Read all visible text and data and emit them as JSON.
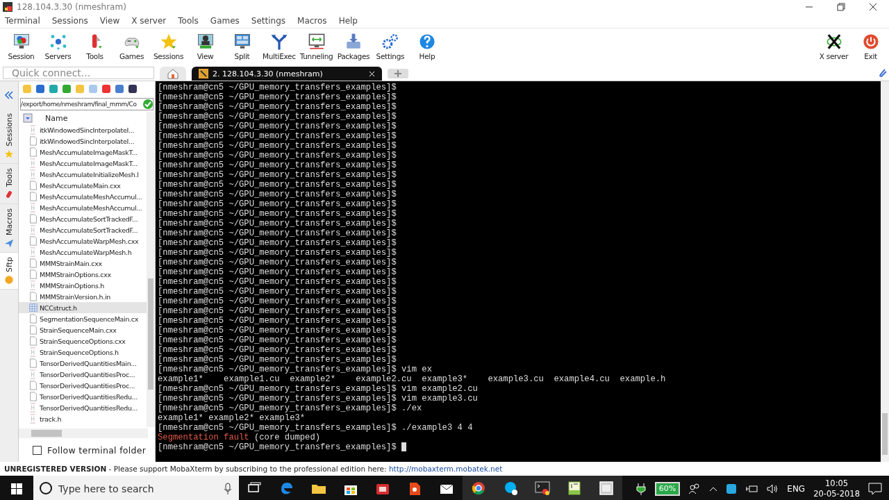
{
  "window": {
    "title": "128.104.3.30 (nmeshram)"
  },
  "menu": [
    "Terminal",
    "Sessions",
    "View",
    "X server",
    "Tools",
    "Games",
    "Settings",
    "Macros",
    "Help"
  ],
  "toolbar": [
    {
      "label": "Session",
      "kind": "monitor"
    },
    {
      "label": "Servers",
      "kind": "network"
    },
    {
      "label": "Tools",
      "kind": "knife"
    },
    {
      "label": "Games",
      "kind": "gamepad"
    },
    {
      "label": "Sessions",
      "kind": "star"
    },
    {
      "label": "View",
      "kind": "person"
    },
    {
      "label": "Split",
      "kind": "split"
    },
    {
      "label": "MultiExec",
      "kind": "fork"
    },
    {
      "label": "Tunneling",
      "kind": "tunnel"
    },
    {
      "label": "Packages",
      "kind": "package"
    },
    {
      "label": "Settings",
      "kind": "gears"
    },
    {
      "label": "Help",
      "kind": "help"
    }
  ],
  "toolbar_right": [
    {
      "label": "X server",
      "kind": "xlogo"
    },
    {
      "label": "Exit",
      "kind": "power"
    }
  ],
  "quick_connect": {
    "placeholder": "Quick connect..."
  },
  "tabs": [
    {
      "kind": "home",
      "selected": false
    },
    {
      "kind": "session",
      "label": "2. 128.104.3.30 (nmeshram)",
      "selected": true
    }
  ],
  "side_tabs": [
    {
      "label": "Sessions",
      "kind": "star",
      "selected": false
    },
    {
      "label": "Tools",
      "kind": "knife",
      "selected": false
    },
    {
      "label": "Macros",
      "kind": "plane",
      "selected": false
    },
    {
      "label": "Sftp",
      "kind": "globe",
      "selected": true
    }
  ],
  "sftp": {
    "path": "/export/home/nmeshram/final_mmm/Co",
    "column": "Name",
    "files": [
      {
        "name": "itkWindowedSincInterpolateI...",
        "kind": "header",
        "selected": false
      },
      {
        "name": "itkWindowedSincInterpolateI...",
        "kind": "doc",
        "selected": false
      },
      {
        "name": "MeshAccumulateImageMaskT...",
        "kind": "doc",
        "selected": false
      },
      {
        "name": "MeshAccumulateImageMaskT...",
        "kind": "header",
        "selected": false
      },
      {
        "name": "MeshAccumulateInitializeMesh.l",
        "kind": "header",
        "selected": false
      },
      {
        "name": "MeshAccumulateMain.cxx",
        "kind": "doc",
        "selected": false
      },
      {
        "name": "MeshAccumulateMeshAccumul...",
        "kind": "doc",
        "selected": false
      },
      {
        "name": "MeshAccumulateMeshAccumul...",
        "kind": "header",
        "selected": false
      },
      {
        "name": "MeshAccumulateSortTrackedF...",
        "kind": "doc",
        "selected": false
      },
      {
        "name": "MeshAccumulateSortTrackedF...",
        "kind": "header",
        "selected": false
      },
      {
        "name": "MeshAccumulateWarpMesh.cxx",
        "kind": "doc",
        "selected": false
      },
      {
        "name": "MeshAccumulateWarpMesh.h",
        "kind": "header",
        "selected": false
      },
      {
        "name": "MMMStrainMain.cxx",
        "kind": "doc",
        "selected": false
      },
      {
        "name": "MMMStrainOptions.cxx",
        "kind": "doc",
        "selected": false
      },
      {
        "name": "MMMStrainOptions.h",
        "kind": "header",
        "selected": false
      },
      {
        "name": "MMMStrainVersion.h.in",
        "kind": "doc",
        "selected": false
      },
      {
        "name": "NCCstruct.h",
        "kind": "grid",
        "selected": true
      },
      {
        "name": "SegmentationSequenceMain.cx",
        "kind": "doc",
        "selected": false
      },
      {
        "name": "StrainSequenceMain.cxx",
        "kind": "doc",
        "selected": false
      },
      {
        "name": "StrainSequenceOptions.cxx",
        "kind": "doc",
        "selected": false
      },
      {
        "name": "StrainSequenceOptions.h",
        "kind": "header",
        "selected": false
      },
      {
        "name": "TensorDerivedQuantitiesMain...",
        "kind": "doc",
        "selected": false
      },
      {
        "name": "TensorDerivedQuantitiesProc...",
        "kind": "header",
        "selected": false
      },
      {
        "name": "TensorDerivedQuantitiesProc...",
        "kind": "doc",
        "selected": false
      },
      {
        "name": "TensorDerivedQuantitiesRedu...",
        "kind": "doc",
        "selected": false
      },
      {
        "name": "TensorDerivedQuantitiesRedu...",
        "kind": "header",
        "selected": false
      },
      {
        "name": "track.h",
        "kind": "header",
        "selected": false
      }
    ],
    "follow_terminal": {
      "label": "Follow terminal folder",
      "checked": false
    }
  },
  "terminal": {
    "lines": [
      [
        {
          "text": "[nmeshram@cn5 ~/GPU_memory_transfers_examples]$",
          "kind": "normal"
        }
      ],
      [
        {
          "text": "[nmeshram@cn5 ~/GPU_memory_transfers_examples]$",
          "kind": "normal"
        }
      ],
      [
        {
          "text": "[nmeshram@cn5 ~/GPU_memory_transfers_examples]$",
          "kind": "normal"
        }
      ],
      [
        {
          "text": "[nmeshram@cn5 ~/GPU_memory_transfers_examples]$",
          "kind": "normal"
        }
      ],
      [
        {
          "text": "[nmeshram@cn5 ~/GPU_memory_transfers_examples]$",
          "kind": "normal"
        }
      ],
      [
        {
          "text": "[nmeshram@cn5 ~/GPU_memory_transfers_examples]$",
          "kind": "normal"
        }
      ],
      [
        {
          "text": "[nmeshram@cn5 ~/GPU_memory_transfers_examples]$",
          "kind": "normal"
        }
      ],
      [
        {
          "text": "[nmeshram@cn5 ~/GPU_memory_transfers_examples]$",
          "kind": "normal"
        }
      ],
      [
        {
          "text": "[nmeshram@cn5 ~/GPU_memory_transfers_examples]$",
          "kind": "normal"
        }
      ],
      [
        {
          "text": "[nmeshram@cn5 ~/GPU_memory_transfers_examples]$",
          "kind": "normal"
        }
      ],
      [
        {
          "text": "[nmeshram@cn5 ~/GPU_memory_transfers_examples]$",
          "kind": "normal"
        }
      ],
      [
        {
          "text": "[nmeshram@cn5 ~/GPU_memory_transfers_examples]$",
          "kind": "normal"
        }
      ],
      [
        {
          "text": "[nmeshram@cn5 ~/GPU_memory_transfers_examples]$",
          "kind": "normal"
        }
      ],
      [
        {
          "text": "[nmeshram@cn5 ~/GPU_memory_transfers_examples]$",
          "kind": "normal"
        }
      ],
      [
        {
          "text": "[nmeshram@cn5 ~/GPU_memory_transfers_examples]$",
          "kind": "normal"
        }
      ],
      [
        {
          "text": "[nmeshram@cn5 ~/GPU_memory_transfers_examples]$",
          "kind": "normal"
        }
      ],
      [
        {
          "text": "[nmeshram@cn5 ~/GPU_memory_transfers_examples]$",
          "kind": "normal"
        }
      ],
      [
        {
          "text": "[nmeshram@cn5 ~/GPU_memory_transfers_examples]$",
          "kind": "normal"
        }
      ],
      [
        {
          "text": "[nmeshram@cn5 ~/GPU_memory_transfers_examples]$",
          "kind": "normal"
        }
      ],
      [
        {
          "text": "[nmeshram@cn5 ~/GPU_memory_transfers_examples]$",
          "kind": "normal"
        }
      ],
      [
        {
          "text": "[nmeshram@cn5 ~/GPU_memory_transfers_examples]$",
          "kind": "normal"
        }
      ],
      [
        {
          "text": "[nmeshram@cn5 ~/GPU_memory_transfers_examples]$",
          "kind": "normal"
        }
      ],
      [
        {
          "text": "[nmeshram@cn5 ~/GPU_memory_transfers_examples]$",
          "kind": "normal"
        }
      ],
      [
        {
          "text": "[nmeshram@cn5 ~/GPU_memory_transfers_examples]$",
          "kind": "normal"
        }
      ],
      [
        {
          "text": "[nmeshram@cn5 ~/GPU_memory_transfers_examples]$",
          "kind": "normal"
        }
      ],
      [
        {
          "text": "[nmeshram@cn5 ~/GPU_memory_transfers_examples]$",
          "kind": "normal"
        }
      ],
      [
        {
          "text": "[nmeshram@cn5 ~/GPU_memory_transfers_examples]$",
          "kind": "normal"
        }
      ],
      [
        {
          "text": "[nmeshram@cn5 ~/GPU_memory_transfers_examples]$",
          "kind": "normal"
        }
      ],
      [
        {
          "text": "[nmeshram@cn5 ~/GPU_memory_transfers_examples]$",
          "kind": "normal"
        }
      ],
      [
        {
          "text": "[nmeshram@cn5 ~/GPU_memory_transfers_examples]$ vim ex",
          "kind": "normal"
        }
      ],
      [
        {
          "text": "example1*    example1.cu  example2*    example2.cu  example3*    example3.cu  example4.cu  example.h",
          "kind": "normal"
        }
      ],
      [
        {
          "text": "[nmeshram@cn5 ~/GPU_memory_transfers_examples]$ vim example2.cu",
          "kind": "normal"
        }
      ],
      [
        {
          "text": "[nmeshram@cn5 ~/GPU_memory_transfers_examples]$ vim example3.cu",
          "kind": "normal"
        }
      ],
      [
        {
          "text": "[nmeshram@cn5 ~/GPU_memory_transfers_examples]$ ./ex",
          "kind": "normal"
        }
      ],
      [
        {
          "text": "example1* example2* example3*",
          "kind": "normal"
        }
      ],
      [
        {
          "text": "[nmeshram@cn5 ~/GPU_memory_transfers_examples]$ ./example3 4 4",
          "kind": "normal"
        }
      ],
      [
        {
          "text": "Segmentation fault",
          "kind": "error"
        },
        {
          "text": " (core dumped)",
          "kind": "normal"
        }
      ],
      [
        {
          "text": "[nmeshram@cn5 ~/GPU_memory_transfers_examples]$ ",
          "kind": "normal"
        },
        {
          "kind": "cursor"
        }
      ]
    ]
  },
  "status_bar": {
    "label": "UNREGISTERED VERSION",
    "message": " -  Please support MobaXterm by subscribing to the professional edition here: ",
    "link": "http://mobaxterm.mobatek.net"
  },
  "taskbar": {
    "search_placeholder": "Type here to search",
    "apps": [
      {
        "kind": "taskview",
        "running": false
      },
      {
        "kind": "edge",
        "running": false
      },
      {
        "kind": "folder",
        "running": false
      },
      {
        "kind": "store",
        "running": false
      },
      {
        "kind": "red",
        "running": false
      },
      {
        "kind": "orange",
        "running": false
      },
      {
        "kind": "mail",
        "running": false
      },
      {
        "kind": "chrome",
        "running": true
      },
      {
        "kind": "skype",
        "running": true
      },
      {
        "kind": "terminal",
        "running": true
      },
      {
        "kind": "editor",
        "running": true
      },
      {
        "kind": "window",
        "running": true
      }
    ],
    "battery": "60%",
    "language": "ENG",
    "time": "10:05",
    "date": "20-05-2018"
  }
}
